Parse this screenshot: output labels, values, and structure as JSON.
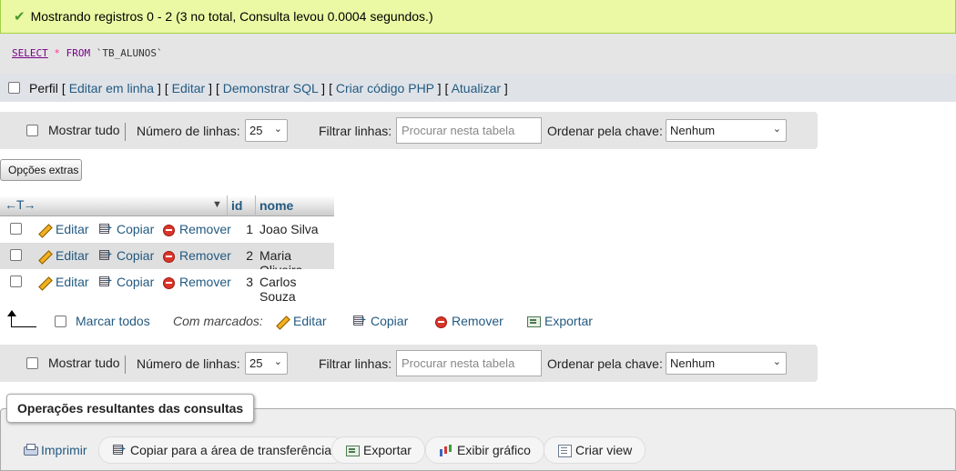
{
  "success": {
    "message": "Mostrando registros 0 - 2 (3 no total, Consulta levou 0.0004 segundos.)"
  },
  "sql": {
    "select": "SELECT",
    "star": "*",
    "from": "FROM",
    "table": "`TB_ALUNOS`"
  },
  "profile": {
    "label": "Perfil",
    "links": [
      "Editar em linha",
      "Editar",
      "Demonstrar SQL",
      "Criar código PHP",
      "Atualizar"
    ]
  },
  "navbar": {
    "show_all": "Mostrar tudo",
    "rows_label": "Número de linhas:",
    "rows_value": "25",
    "filter_label": "Filtrar linhas:",
    "filter_placeholder": "Procurar nesta tabela",
    "order_label": "Ordenar pela chave:",
    "order_value": "Nenhum"
  },
  "extra_options": "Opções extras",
  "table": {
    "columns": [
      "id",
      "nome"
    ],
    "actions": {
      "edit": "Editar",
      "copy": "Copiar",
      "delete": "Remover"
    },
    "rows": [
      {
        "id": "1",
        "nome": "Joao Silva"
      },
      {
        "id": "2",
        "nome": "Maria Oliveira"
      },
      {
        "id": "3",
        "nome": "Carlos Souza"
      }
    ]
  },
  "with_selected": {
    "check_all": "Marcar todos",
    "label": "Com marcados:",
    "edit": "Editar",
    "copy": "Copiar",
    "delete": "Remover",
    "export": "Exportar"
  },
  "operations": {
    "legend": "Operações resultantes das consultas",
    "print": "Imprimir",
    "copy_clipboard": "Copiar para a área de transferência",
    "export": "Exportar",
    "chart": "Exibir gráfico",
    "create_view": "Criar view"
  }
}
